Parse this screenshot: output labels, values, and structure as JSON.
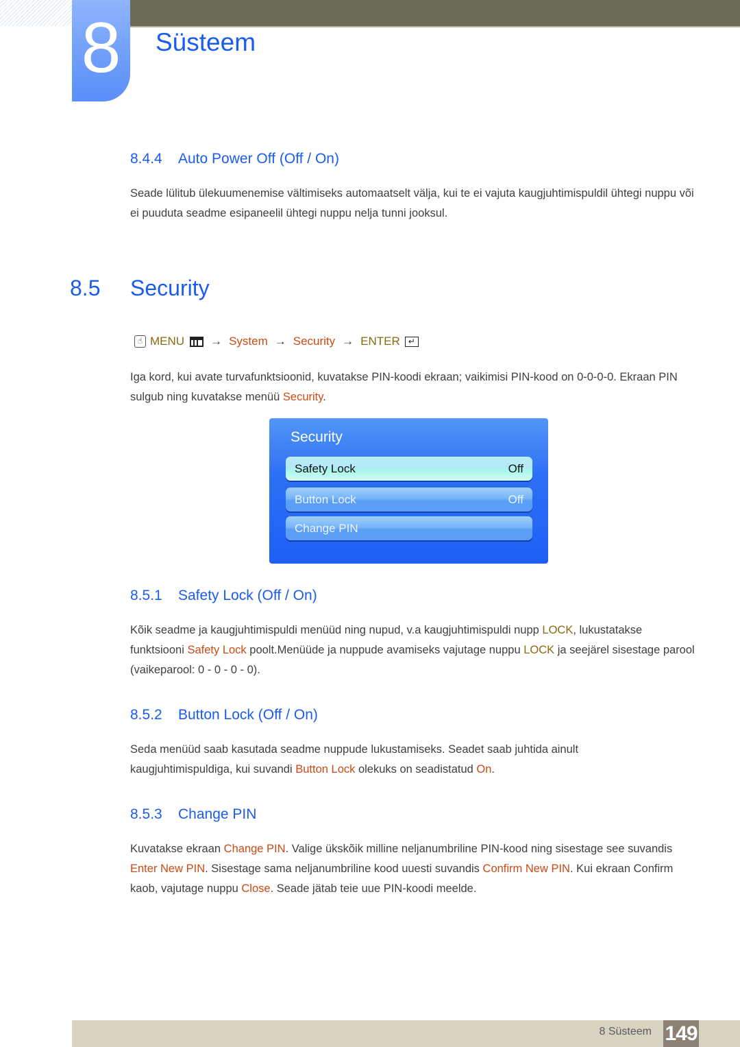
{
  "header": {
    "chapter_number": "8",
    "chapter_title": "Süsteem"
  },
  "section_844": {
    "number": "8.4.4",
    "title": "Auto Power Off (Off / On)",
    "body": "Seade lülitub ülekuumenemise vältimiseks automaatselt välja, kui te ei vajuta kaugjuhtimispuldil ühtegi nuppu või ei puuduta seadme esipaneelil ühtegi nuppu nelja tunni jooksul."
  },
  "section_85": {
    "number": "8.5",
    "title": "Security",
    "nav": {
      "menu": "MENU",
      "arrow": "→",
      "system": "System",
      "security": "Security",
      "enter": "ENTER"
    },
    "body_text": "Iga kord, kui avate turvafunktsioonid, kuvatakse PIN-koodi ekraan; vaikimisi PIN-kood on 0-0-0-0. Ekraan PIN sulgub ning kuvatakse menüü ",
    "body_highlight": "Security",
    "body_end": "."
  },
  "security_panel": {
    "title": "Security",
    "items": [
      {
        "label": "Safety Lock",
        "value": "Off",
        "selected": true
      },
      {
        "label": "Button Lock",
        "value": "Off",
        "selected": false
      },
      {
        "label": "Change PIN",
        "value": "",
        "selected": false
      }
    ]
  },
  "section_851": {
    "number": "8.5.1",
    "title": "Safety Lock (Off / On)",
    "p1": "Kõik seadme ja kaugjuhtimispuldi menüüd ning nupud, v.a kaugjuhtimispuldi nupp ",
    "hl1": "LOCK",
    "p2": ", lukustatakse funktsiooni ",
    "hl2": "Safety Lock",
    "p3": " poolt.Menüüde ja nuppude avamiseks vajutage nuppu ",
    "hl3": "LOCK",
    "p4": "  ja seejärel sisestage parool (vaikeparool: 0 - 0 - 0 - 0)."
  },
  "section_852": {
    "number": "8.5.2",
    "title": "Button Lock (Off / On)",
    "p1": "Seda menüüd saab kasutada seadme nuppude lukustamiseks. Seadet saab juhtida ainult kaugjuhtimispuldiga, kui suvandi ",
    "hl1": "Button Lock",
    "p2": " olekuks on seadistatud ",
    "hl2": "On",
    "p3": "."
  },
  "section_853": {
    "number": "8.5.3",
    "title": "Change PIN",
    "p1": "Kuvatakse ekraan ",
    "hl1": "Change PIN",
    "p2": ". Valige ükskõik milline neljanumbriline PIN-kood ning sisestage see suvandis ",
    "hl2": "Enter New PIN",
    "p3": ". Sisestage sama neljanumbriline kood uuesti suvandis ",
    "hl3": "Confirm New PIN",
    "p4": ". Kui ekraan Confirm kaob, vajutage nuppu ",
    "hl4": "Close",
    "p5": ". Seade jätab teie uue PIN-koodi meelde."
  },
  "footer": {
    "chapter_label": "8 Süsteem",
    "page_number": "149"
  }
}
